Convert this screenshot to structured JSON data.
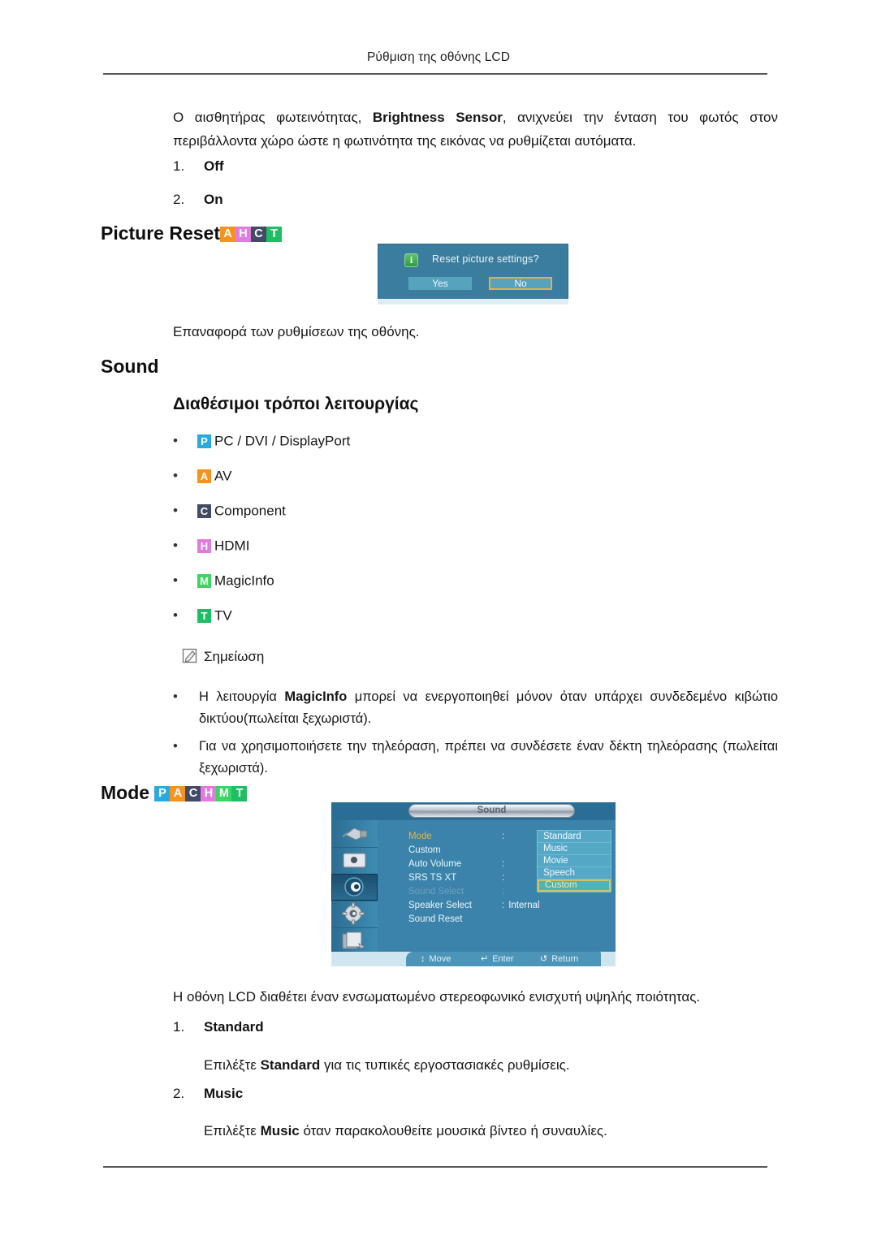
{
  "header": {
    "title": "Ρύθμιση της οθόνης LCD"
  },
  "intro": {
    "text_before": "Ο αισθητήρας φωτεινότητας, ",
    "bold": "Brightness Sensor",
    "text_after": ", ανιχνεύει την ένταση του φωτός στον περιβάλλοντα χώρο ώστε η φωτινότητα της εικόνας να ρυθμίζεται αυτόματα."
  },
  "brightness_sensor_options": [
    {
      "num": "1.",
      "label": "Off"
    },
    {
      "num": "2.",
      "label": "On"
    }
  ],
  "picture_reset": {
    "heading": "Picture Reset",
    "badges": [
      {
        "letter": "A",
        "color": "#F6921E"
      },
      {
        "letter": "H",
        "color": "#E07BE0"
      },
      {
        "letter": "C",
        "color": "#414B63"
      },
      {
        "letter": "T",
        "color": "#1DBE64"
      }
    ],
    "caption": "Επαναφορά των ρυθμίσεων της οθόνης."
  },
  "reset_dialog": {
    "icon": "info-icon",
    "message": "Reset picture settings?",
    "yes_label": "Yes",
    "no_label": "No",
    "selected": "No"
  },
  "sound_section": {
    "heading": "Sound",
    "subheading": "Διαθέσιμοι τρόποι λειτουργίας",
    "modes": [
      {
        "letter": "P",
        "color": "#29ABE2",
        "label": "PC / DVI / DisplayPort"
      },
      {
        "letter": "A",
        "color": "#F6921E",
        "label": "AV"
      },
      {
        "letter": "C",
        "color": "#414B63",
        "label": "Component"
      },
      {
        "letter": "H",
        "color": "#E07BE0",
        "label": "HDMI"
      },
      {
        "letter": "M",
        "color": "#3ED463",
        "label": "MagicInfo"
      },
      {
        "letter": "T",
        "color": "#1DBE64",
        "label": "TV"
      }
    ]
  },
  "note": {
    "icon": "note-icon",
    "title": "Σημείωση",
    "items": [
      {
        "before": "Η λειτουργία ",
        "bold": "MagicInfo",
        "after": " μπορεί να ενεργοποιηθεί μόνον όταν υπάρχει συνδεδεμένο κιβώτιο δικτύου(πωλείται ξεχωριστά)."
      },
      {
        "before": "Για να χρησιμοποιήσετε την τηλεόραση, πρέπει να συνδέσετε έναν δέκτη τηλεόρασης (πωλείται ξεχωριστά).",
        "bold": "",
        "after": ""
      }
    ]
  },
  "mode_section": {
    "heading": "Mode",
    "badges": [
      {
        "letter": "P",
        "color": "#29ABE2"
      },
      {
        "letter": "A",
        "color": "#F6921E"
      },
      {
        "letter": "C",
        "color": "#414B63"
      },
      {
        "letter": "H",
        "color": "#E07BE0"
      },
      {
        "letter": "M",
        "color": "#3ED463"
      },
      {
        "letter": "T",
        "color": "#1DBE64"
      }
    ],
    "description": "Η οθόνη LCD διαθέτει έναν ενσωματωμένο στερεοφωνικό ενισχυτή υψηλής ποιότητας.",
    "items": [
      {
        "num": "1.",
        "title": "Standard",
        "desc_before": "Επιλέξτε ",
        "desc_bold": "Standard",
        "desc_after": " για τις τυπικές εργοστασιακές ρυθμίσεις."
      },
      {
        "num": "2.",
        "title": "Music",
        "desc_before": "Επιλέξτε ",
        "desc_bold": "Music",
        "desc_after": " όταν παρακολουθείτε μουσικά βίντεο ή συναυλίες."
      }
    ]
  },
  "sound_osd": {
    "title": "Sound",
    "sidebar_icons": [
      "input-source-icon",
      "picture-icon",
      "sound-icon",
      "setup-gear-icon",
      "multi-control-icon"
    ],
    "active_sidebar_index": 2,
    "rows": [
      {
        "label": "Mode",
        "colon": ":",
        "value": "",
        "state": "highlight"
      },
      {
        "label": "Custom",
        "colon": "",
        "value": "",
        "state": "normal"
      },
      {
        "label": "Auto Volume",
        "colon": ":",
        "value": "",
        "state": "normal"
      },
      {
        "label": "SRS TS XT",
        "colon": ":",
        "value": "",
        "state": "normal"
      },
      {
        "label": "Sound Select",
        "colon": ":",
        "value": "",
        "state": "disabled"
      },
      {
        "label": "Speaker Select",
        "colon": ":",
        "value": "Internal",
        "state": "normal"
      },
      {
        "label": "Sound Reset",
        "colon": "",
        "value": "",
        "state": "normal"
      }
    ],
    "dropdown": {
      "options": [
        "Standard",
        "Music",
        "Movie",
        "Speech",
        "Custom"
      ],
      "selected": "Custom"
    },
    "hints": [
      {
        "glyph": "↕",
        "label": "Move"
      },
      {
        "glyph": "↵",
        "label": "Enter"
      },
      {
        "glyph": "↺",
        "label": "Return"
      }
    ]
  }
}
